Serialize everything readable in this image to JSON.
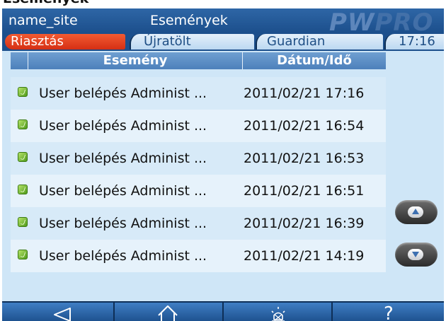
{
  "page": {
    "heading": "Események"
  },
  "header": {
    "site_name": "name_site",
    "title": "Események",
    "logo": "PW PRO"
  },
  "tabs": [
    {
      "label": "Riasztás",
      "active": true
    },
    {
      "label": "Újratölt",
      "active": false
    },
    {
      "label": "Guardian",
      "active": false
    }
  ],
  "clock": "17:16",
  "table": {
    "columns": [
      "",
      "Esemény",
      "Dátum/Idő"
    ],
    "rows": [
      {
        "icon": "green-check-icon",
        "event": "User belépés Administ ...",
        "date": "2011/02/21 17:16"
      },
      {
        "icon": "green-check-icon",
        "event": "User belépés Administ ...",
        "date": "2011/02/21 16:54"
      },
      {
        "icon": "green-check-icon",
        "event": "User belépés Administ ...",
        "date": "2011/02/21 16:53"
      },
      {
        "icon": "green-check-icon",
        "event": "User belépés Administ ...",
        "date": "2011/02/21 16:51"
      },
      {
        "icon": "green-check-icon",
        "event": "User belépés Administ ...",
        "date": "2011/02/21 16:39"
      },
      {
        "icon": "green-check-icon",
        "event": "User belépés Administ ...",
        "date": "2011/02/21 14:19"
      }
    ]
  },
  "scroll": {
    "up_icon": "scroll-up-arrow-icon",
    "down_icon": "scroll-down-arrow-icon"
  },
  "bottom_nav": [
    {
      "icon": "back-arrow-icon"
    },
    {
      "icon": "home-icon"
    },
    {
      "icon": "alarm-light-icon"
    },
    {
      "icon": "help-icon",
      "label": "?"
    }
  ],
  "colors": {
    "title_bar": "#1c4f8c",
    "active_tab": "#e03b1e",
    "table_header": "#5b8cc6",
    "screen_bg": "#cfe6f7"
  }
}
